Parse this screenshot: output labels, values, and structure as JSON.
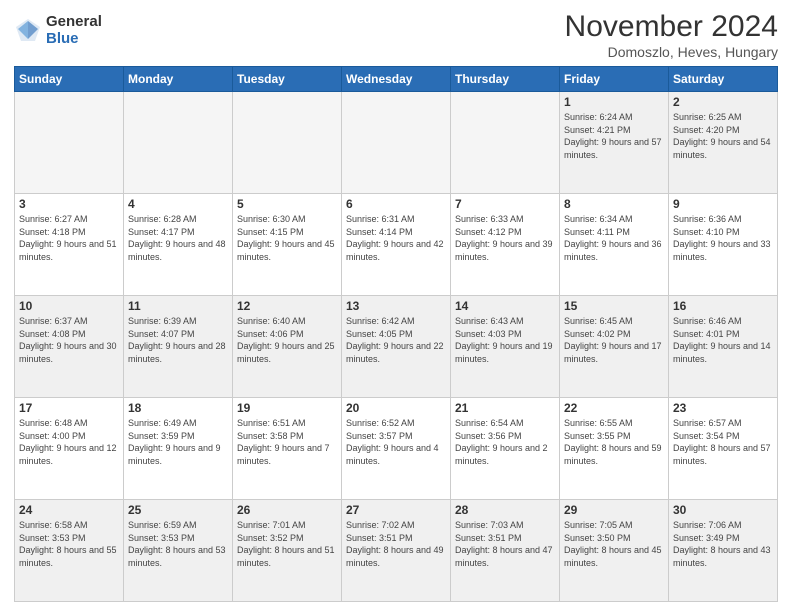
{
  "logo": {
    "general": "General",
    "blue": "Blue"
  },
  "title": {
    "month": "November 2024",
    "location": "Domoszlo, Heves, Hungary"
  },
  "headers": [
    "Sunday",
    "Monday",
    "Tuesday",
    "Wednesday",
    "Thursday",
    "Friday",
    "Saturday"
  ],
  "weeks": [
    [
      {
        "day": "",
        "info": ""
      },
      {
        "day": "",
        "info": ""
      },
      {
        "day": "",
        "info": ""
      },
      {
        "day": "",
        "info": ""
      },
      {
        "day": "",
        "info": ""
      },
      {
        "day": "1",
        "info": "Sunrise: 6:24 AM\nSunset: 4:21 PM\nDaylight: 9 hours and 57 minutes."
      },
      {
        "day": "2",
        "info": "Sunrise: 6:25 AM\nSunset: 4:20 PM\nDaylight: 9 hours and 54 minutes."
      }
    ],
    [
      {
        "day": "3",
        "info": "Sunrise: 6:27 AM\nSunset: 4:18 PM\nDaylight: 9 hours and 51 minutes."
      },
      {
        "day": "4",
        "info": "Sunrise: 6:28 AM\nSunset: 4:17 PM\nDaylight: 9 hours and 48 minutes."
      },
      {
        "day": "5",
        "info": "Sunrise: 6:30 AM\nSunset: 4:15 PM\nDaylight: 9 hours and 45 minutes."
      },
      {
        "day": "6",
        "info": "Sunrise: 6:31 AM\nSunset: 4:14 PM\nDaylight: 9 hours and 42 minutes."
      },
      {
        "day": "7",
        "info": "Sunrise: 6:33 AM\nSunset: 4:12 PM\nDaylight: 9 hours and 39 minutes."
      },
      {
        "day": "8",
        "info": "Sunrise: 6:34 AM\nSunset: 4:11 PM\nDaylight: 9 hours and 36 minutes."
      },
      {
        "day": "9",
        "info": "Sunrise: 6:36 AM\nSunset: 4:10 PM\nDaylight: 9 hours and 33 minutes."
      }
    ],
    [
      {
        "day": "10",
        "info": "Sunrise: 6:37 AM\nSunset: 4:08 PM\nDaylight: 9 hours and 30 minutes."
      },
      {
        "day": "11",
        "info": "Sunrise: 6:39 AM\nSunset: 4:07 PM\nDaylight: 9 hours and 28 minutes."
      },
      {
        "day": "12",
        "info": "Sunrise: 6:40 AM\nSunset: 4:06 PM\nDaylight: 9 hours and 25 minutes."
      },
      {
        "day": "13",
        "info": "Sunrise: 6:42 AM\nSunset: 4:05 PM\nDaylight: 9 hours and 22 minutes."
      },
      {
        "day": "14",
        "info": "Sunrise: 6:43 AM\nSunset: 4:03 PM\nDaylight: 9 hours and 19 minutes."
      },
      {
        "day": "15",
        "info": "Sunrise: 6:45 AM\nSunset: 4:02 PM\nDaylight: 9 hours and 17 minutes."
      },
      {
        "day": "16",
        "info": "Sunrise: 6:46 AM\nSunset: 4:01 PM\nDaylight: 9 hours and 14 minutes."
      }
    ],
    [
      {
        "day": "17",
        "info": "Sunrise: 6:48 AM\nSunset: 4:00 PM\nDaylight: 9 hours and 12 minutes."
      },
      {
        "day": "18",
        "info": "Sunrise: 6:49 AM\nSunset: 3:59 PM\nDaylight: 9 hours and 9 minutes."
      },
      {
        "day": "19",
        "info": "Sunrise: 6:51 AM\nSunset: 3:58 PM\nDaylight: 9 hours and 7 minutes."
      },
      {
        "day": "20",
        "info": "Sunrise: 6:52 AM\nSunset: 3:57 PM\nDaylight: 9 hours and 4 minutes."
      },
      {
        "day": "21",
        "info": "Sunrise: 6:54 AM\nSunset: 3:56 PM\nDaylight: 9 hours and 2 minutes."
      },
      {
        "day": "22",
        "info": "Sunrise: 6:55 AM\nSunset: 3:55 PM\nDaylight: 8 hours and 59 minutes."
      },
      {
        "day": "23",
        "info": "Sunrise: 6:57 AM\nSunset: 3:54 PM\nDaylight: 8 hours and 57 minutes."
      }
    ],
    [
      {
        "day": "24",
        "info": "Sunrise: 6:58 AM\nSunset: 3:53 PM\nDaylight: 8 hours and 55 minutes."
      },
      {
        "day": "25",
        "info": "Sunrise: 6:59 AM\nSunset: 3:53 PM\nDaylight: 8 hours and 53 minutes."
      },
      {
        "day": "26",
        "info": "Sunrise: 7:01 AM\nSunset: 3:52 PM\nDaylight: 8 hours and 51 minutes."
      },
      {
        "day": "27",
        "info": "Sunrise: 7:02 AM\nSunset: 3:51 PM\nDaylight: 8 hours and 49 minutes."
      },
      {
        "day": "28",
        "info": "Sunrise: 7:03 AM\nSunset: 3:51 PM\nDaylight: 8 hours and 47 minutes."
      },
      {
        "day": "29",
        "info": "Sunrise: 7:05 AM\nSunset: 3:50 PM\nDaylight: 8 hours and 45 minutes."
      },
      {
        "day": "30",
        "info": "Sunrise: 7:06 AM\nSunset: 3:49 PM\nDaylight: 8 hours and 43 minutes."
      }
    ]
  ]
}
